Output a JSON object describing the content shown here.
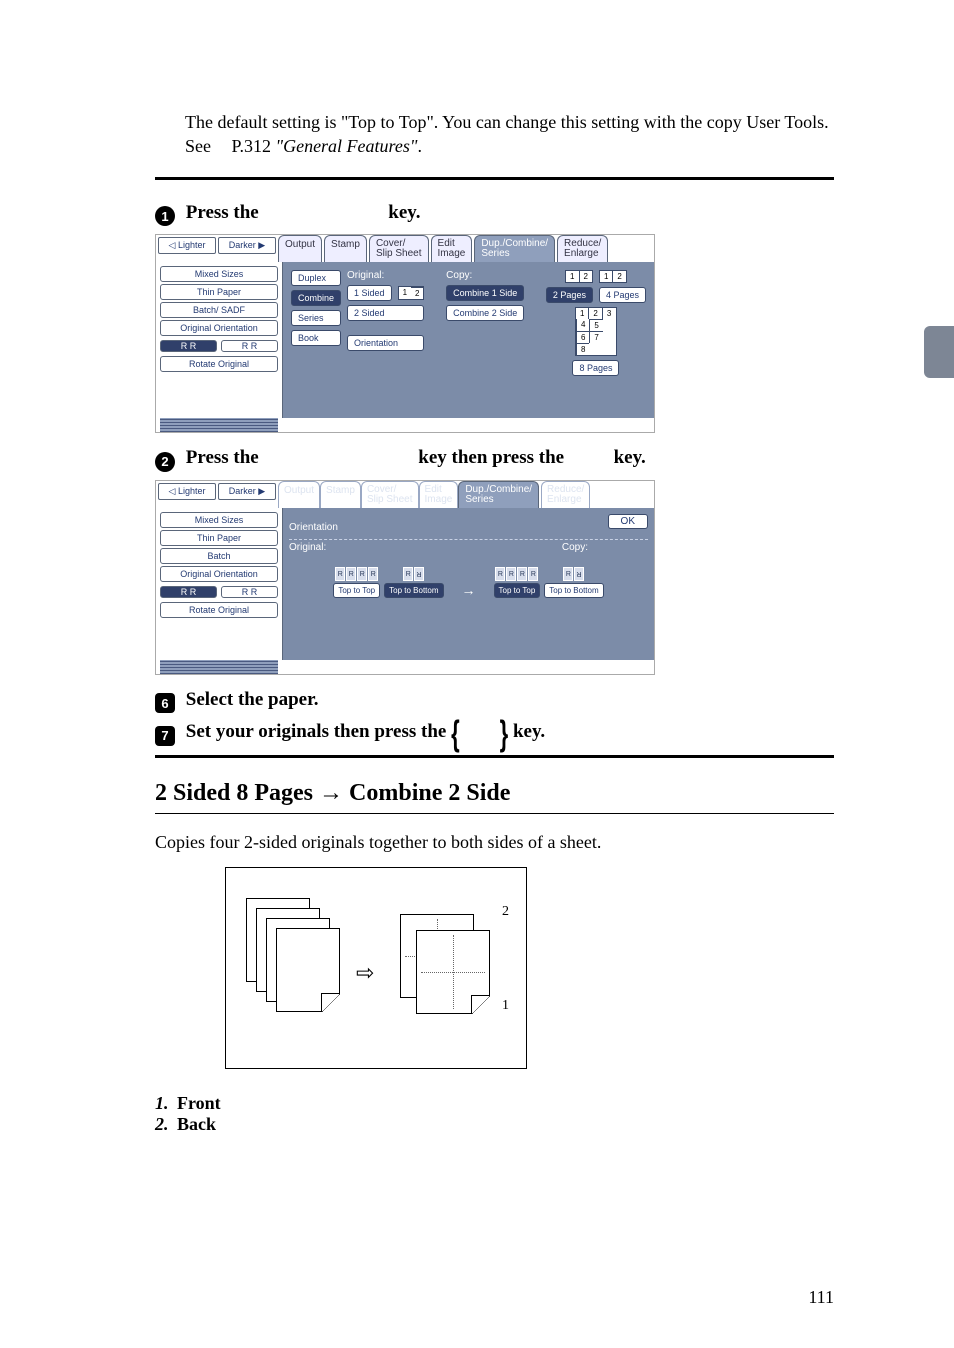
{
  "intro": {
    "text_before": "The default setting is \"Top to Top\". You can change this setting with the copy User Tools. See",
    "ref_page": "P.312",
    "ref_title": "\"General Features\"",
    "period": "."
  },
  "steps": {
    "s1": {
      "num": "1",
      "before": "Press the",
      "after": "key."
    },
    "s2": {
      "num": "2",
      "before": "Press the",
      "mid": "key then press the",
      "after": "key."
    },
    "s3": {
      "num": "6",
      "text": "Select the paper."
    },
    "s4": {
      "num": "7",
      "before": "Set your originals then press the",
      "after": "key."
    }
  },
  "screenshot1": {
    "lighter": "Lighter",
    "darker": "Darker",
    "tabs": {
      "output": "Output",
      "stamp": "Stamp",
      "cover1": "Cover/",
      "cover2": "Slip Sheet",
      "edit1": "Edit",
      "edit2": "Image",
      "dcs1": "Dup./Combine/",
      "dcs2": "Series",
      "re1": "Reduce/",
      "re2": "Enlarge"
    },
    "side": {
      "mixed": "Mixed Sizes",
      "thin": "Thin Paper",
      "batch": "Batch/ SADF",
      "orient": "Original Orientation",
      "rotate": "Rotate Original"
    },
    "left": {
      "duplex": "Duplex",
      "combine": "Combine",
      "series": "Series",
      "book": "Book"
    },
    "labels": {
      "original": "Original:",
      "orientation": "Orientation",
      "copy": "Copy:",
      "sided1": "1 Sided",
      "sided2": "2 Sided",
      "c1": "Combine 1 Side",
      "c2": "Combine 2 Side",
      "p2": "2 Pages",
      "p4": "4 Pages",
      "p8": "8 Pages"
    }
  },
  "screenshot2": {
    "lighter": "Lighter",
    "darker": "Darker",
    "tabs": {
      "output": "Output",
      "stamp": "Stamp",
      "cover1": "Cover/",
      "cover2": "Slip Sheet",
      "edit1": "Edit",
      "edit2": "Image",
      "dcs1": "Dup./Combine/",
      "dcs2": "Series",
      "re1": "Reduce/",
      "re2": "Enlarge"
    },
    "side": {
      "mixed": "Mixed Sizes",
      "thin": "Thin Paper",
      "batch": "Batch",
      "orient": "Original Orientation",
      "rotate": "Rotate Original"
    },
    "orientation": "Orientation",
    "ok": "OK",
    "labels": {
      "original": "Original:",
      "copy": "Copy:",
      "tt": "Top to Top",
      "tb": "Top to Bottom"
    }
  },
  "section": {
    "title": "2 Sided 8 Pages → Combine 2 Side",
    "desc": "Copies four 2-sided originals together to both sides of a sheet.",
    "front_num": "1.",
    "front_label": "Front",
    "back_num": "2.",
    "back_label": "Back"
  },
  "page_number": "111",
  "hatch": "1/2"
}
